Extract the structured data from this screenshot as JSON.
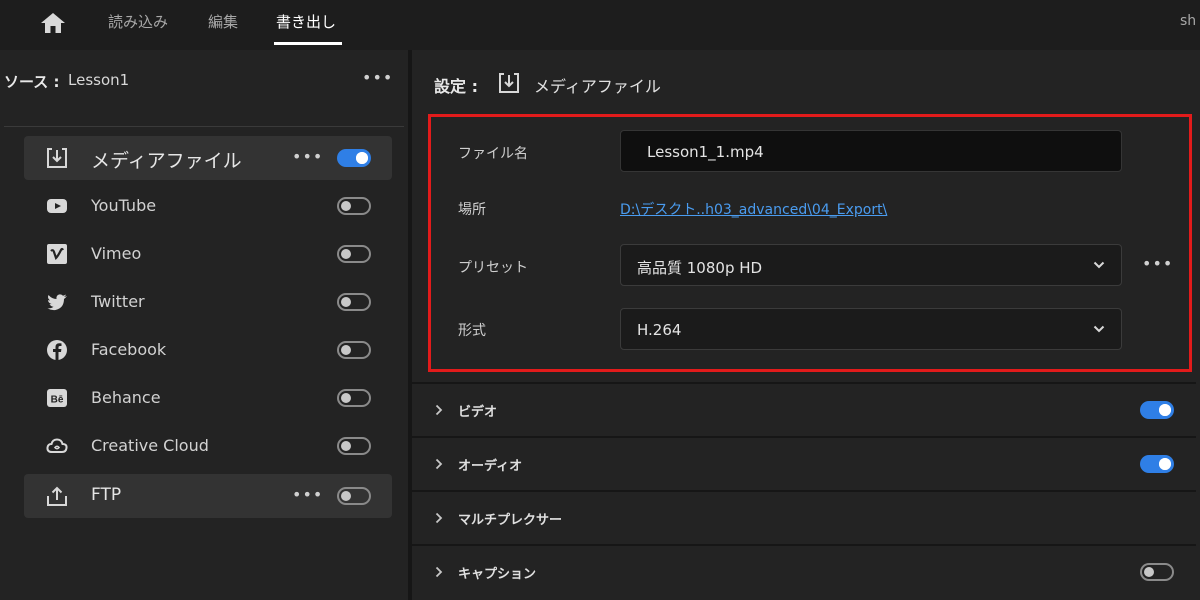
{
  "topbar": {
    "tabs": [
      "読み込み",
      "編集",
      "書き出し"
    ],
    "active_tab": "書き出し",
    "user_clip": "sh"
  },
  "source": {
    "label": "ソース :",
    "name": "Lesson1",
    "more": "•••"
  },
  "destinations": [
    {
      "label": "メディアファイル",
      "icon": "media-file-icon",
      "enabled": true,
      "more": "•••"
    },
    {
      "label": "YouTube",
      "icon": "youtube-icon",
      "enabled": false
    },
    {
      "label": "Vimeo",
      "icon": "vimeo-icon",
      "enabled": false
    },
    {
      "label": "Twitter",
      "icon": "twitter-icon",
      "enabled": false
    },
    {
      "label": "Facebook",
      "icon": "facebook-icon",
      "enabled": false
    },
    {
      "label": "Behance",
      "icon": "behance-icon",
      "enabled": false
    },
    {
      "label": "Creative Cloud",
      "icon": "creative-cloud-icon",
      "enabled": false
    },
    {
      "label": "FTP",
      "icon": "ftp-icon",
      "enabled": false,
      "more": "•••"
    }
  ],
  "settings": {
    "label": "設定 :",
    "target": "メディアファイル",
    "filename_label": "ファイル名",
    "filename_value": "Lesson1_1.mp4",
    "location_label": "場所",
    "location_value": "D:\\デスクト..h03_advanced\\04_Export\\",
    "preset_label": "プリセット",
    "preset_value": "高品質 1080p HD",
    "preset_more": "•••",
    "format_label": "形式",
    "format_value": "H.264"
  },
  "sections": [
    {
      "label": "ビデオ",
      "toggle": true
    },
    {
      "label": "オーディオ",
      "toggle": true
    },
    {
      "label": "マルチプレクサー",
      "toggle": null
    },
    {
      "label": "キャプション",
      "toggle": false
    }
  ],
  "colors": {
    "accent": "#2f7fe6",
    "highlight_box": "#e21b1b",
    "link": "#4a9cf0",
    "background": "#1d1d1d"
  }
}
